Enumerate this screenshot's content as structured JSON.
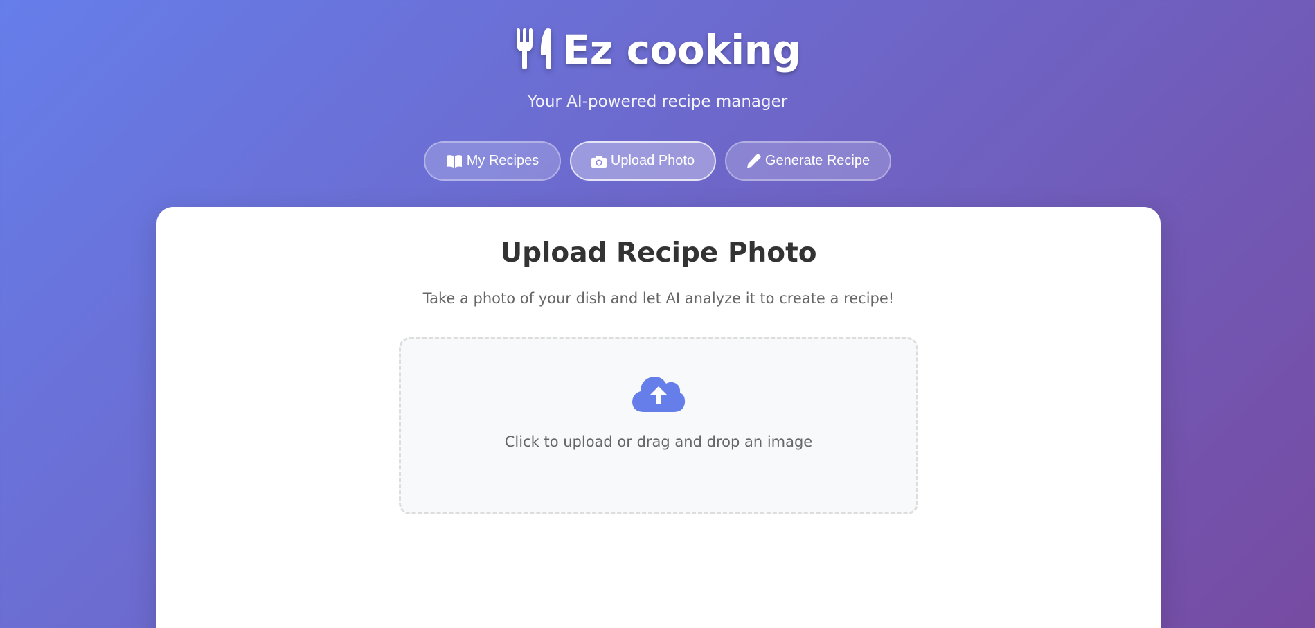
{
  "app": {
    "title": "Ez cooking",
    "subtitle": "Your AI-powered recipe manager",
    "logo_icon": "utensils-icon"
  },
  "nav": {
    "items": [
      {
        "label": "My Recipes",
        "icon": "book-open-icon",
        "active": false
      },
      {
        "label": "Upload Photo",
        "icon": "camera-icon",
        "active": true
      },
      {
        "label": "Generate Recipe",
        "icon": "pencil-icon",
        "active": false
      }
    ]
  },
  "upload": {
    "title": "Upload Recipe Photo",
    "description": "Take a photo of your dish and let AI analyze it to create a recipe!",
    "dropzone_text": "Click to upload or drag and drop an image",
    "dropzone_icon": "cloud-upload-icon"
  },
  "colors": {
    "gradient_start": "#667eea",
    "gradient_end": "#764ba2",
    "accent": "#667eea",
    "heading": "#333333",
    "muted_text": "#666666"
  }
}
